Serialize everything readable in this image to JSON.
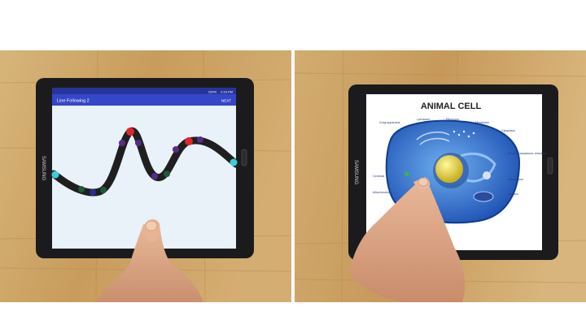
{
  "left_tablet": {
    "brand": "SAMSUNG",
    "status_bar": {
      "time": "2:16 PM",
      "battery": "100%"
    },
    "app_bar": {
      "title": "Line Following 2",
      "next_label": "NEXT"
    }
  },
  "right_tablet": {
    "brand": "SAMSUNG",
    "poster": {
      "title": "ANIMAL CELL",
      "labels": {
        "golgi": "Golgi apparatus",
        "lysosome": "Lysosome",
        "ribosome": "Ribosome",
        "membrane": "Membrane",
        "cytoplasm": "Cytoplasm",
        "rough_er": "Rough endoplasmic reticulum",
        "peroxisome": "Peroxisome",
        "centriole": "Centriole",
        "mitochondrion": "Mitochondrion",
        "nucleus": "Nucleus"
      }
    }
  },
  "colors": {
    "wood": "#c8a266",
    "app_bar": "#3547c9",
    "screen_bg": "#e8f2f8",
    "track": "#1f1f1f",
    "dot_red": "#e0242a",
    "dot_purple": "#5a2a8a",
    "dot_blue": "#2c2d8c",
    "dot_green": "#1f5a3a",
    "cyan_end": "#38d0dc",
    "cell_blue": "#2d6fd0",
    "nucleus_yellow": "#e6d63a"
  }
}
